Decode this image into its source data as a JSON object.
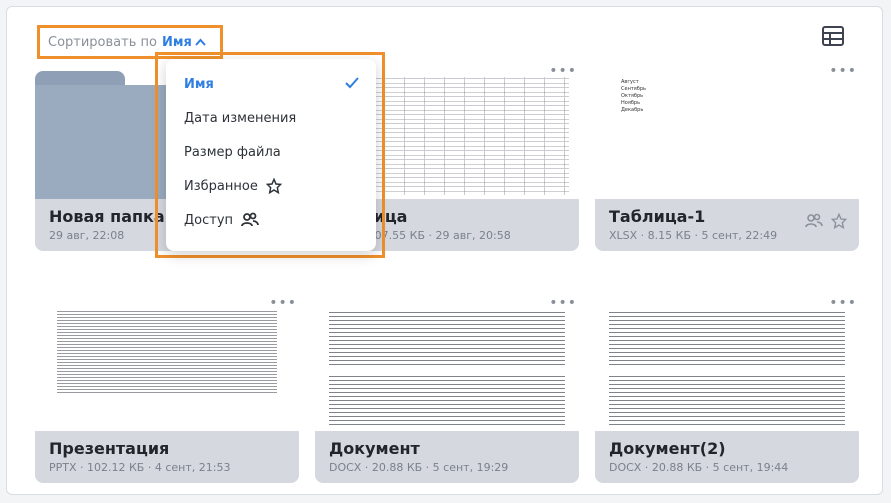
{
  "sort": {
    "label": "Сортировать по",
    "value": "Имя",
    "caret": "^"
  },
  "sort_menu": {
    "items": [
      {
        "label": "Имя",
        "active": true,
        "icon": "check-icon"
      },
      {
        "label": "Дата изменения"
      },
      {
        "label": "Размер файла"
      },
      {
        "label": "Избранное",
        "icon": "star-outline-icon"
      },
      {
        "label": "Доступ",
        "icon": "shared-users-icon"
      }
    ]
  },
  "colors": {
    "accent": "#2f7fe3",
    "highlight": "#f0902c",
    "card_info_bg": "#d5d9df",
    "folder": "#9aabbf"
  },
  "more_label": "•••",
  "files": [
    {
      "name": "Новая папка",
      "meta": "29 авг, 22:08",
      "kind": "folder"
    },
    {
      "name": "Таблица",
      "meta": "XLSX · 107.55 КБ · 29 авг, 20:58",
      "kind": "table"
    },
    {
      "name": "Таблица-1",
      "meta": "XLSX · 8.15 КБ · 5 сент, 22:49",
      "kind": "table-small",
      "shared": true,
      "favorite_outline": true
    },
    {
      "name": "Презентация",
      "meta": "PPTX · 102.12 КБ · 4 сент, 21:53",
      "kind": "presentation"
    },
    {
      "name": "Документ",
      "meta": "DOCX · 20.88 КБ · 5 сент, 19:29",
      "kind": "document"
    },
    {
      "name": "Документ(2)",
      "meta": "DOCX · 20.88 КБ · 5 сент, 19:44",
      "kind": "document"
    }
  ],
  "mini_list": [
    "Август",
    "Сентябрь",
    "Октябрь",
    "Ноябрь",
    "Декабрь"
  ]
}
